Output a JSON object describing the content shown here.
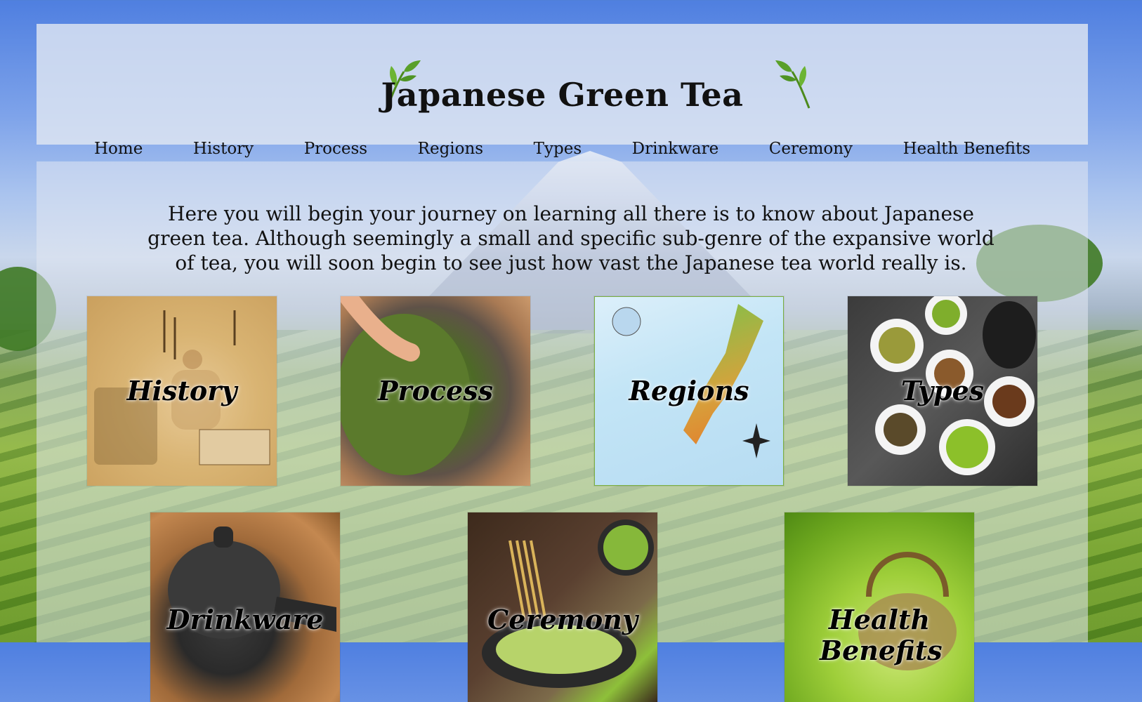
{
  "header": {
    "title": "Japanese Green Tea"
  },
  "nav": [
    {
      "label": "Home"
    },
    {
      "label": "History"
    },
    {
      "label": "Process"
    },
    {
      "label": "Regions"
    },
    {
      "label": "Types"
    },
    {
      "label": "Drinkware"
    },
    {
      "label": "Ceremony"
    },
    {
      "label": "Health Benefits"
    }
  ],
  "intro": "Here you will begin your journey on learning all there is to know about Japanese green tea. Although seemingly a small and specific sub-genre of the expansive world of tea, you will soon begin to see just how vast the Japanese tea world really is.",
  "tiles": [
    {
      "label": "History"
    },
    {
      "label": "Process"
    },
    {
      "label": "Regions"
    },
    {
      "label": "Types"
    },
    {
      "label": "Drinkware"
    },
    {
      "label": "Ceremony"
    },
    {
      "label": "Health Benefits"
    }
  ],
  "colors": {
    "sky": "#4f7fe0",
    "panel": "#e2e8f2",
    "text": "#111111"
  },
  "icons": {
    "sprig": "tea-leaf-sprig-icon"
  }
}
